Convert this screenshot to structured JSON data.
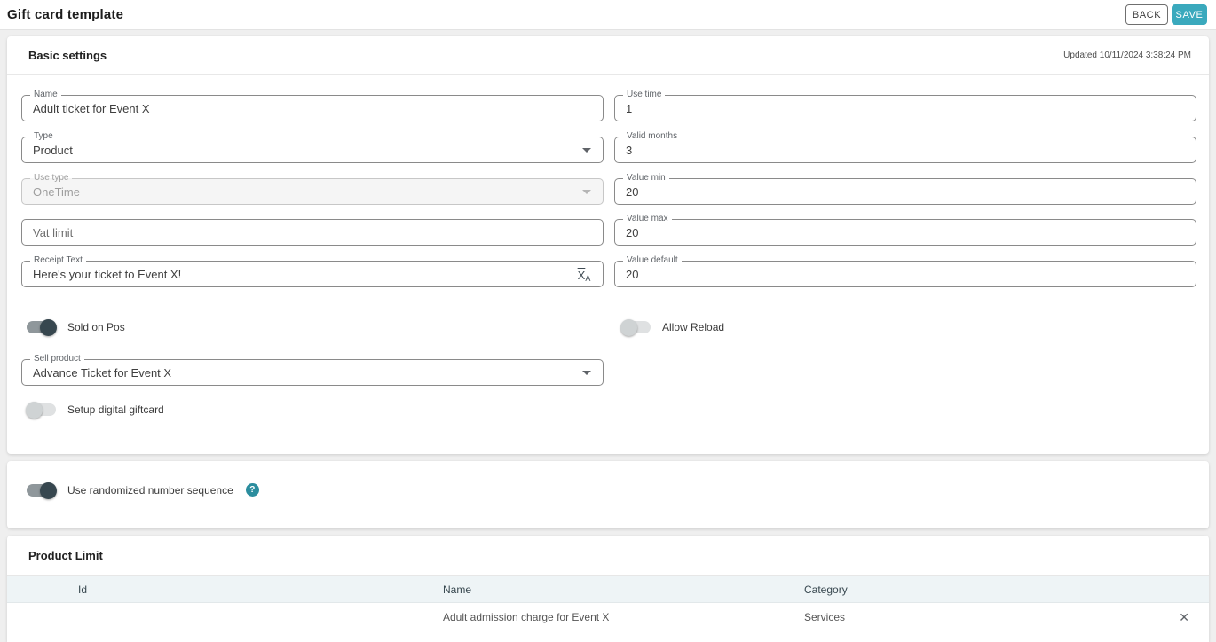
{
  "page": {
    "title": "Gift card template"
  },
  "actions": {
    "back_label": "BACK",
    "save_label": "SAVE"
  },
  "icons": {
    "help": "?",
    "remove": "✕",
    "translate_main": "X",
    "translate_sub": "A"
  },
  "colors": {
    "accent_teal": "#3aa9bd",
    "help_icon_teal": "#2b8d9e",
    "toggle_on_thumb": "#37474f",
    "table_header_bg": "#eef4f6"
  },
  "basic_settings": {
    "section_title": "Basic settings",
    "updated_text": "Updated 10/11/2024 3:38:24 PM",
    "name": {
      "label": "Name",
      "value": "Adult ticket for Event X"
    },
    "use_time": {
      "label": "Use time",
      "value": "1"
    },
    "type": {
      "label": "Type",
      "value": "Product"
    },
    "valid_months": {
      "label": "Valid months",
      "value": "3"
    },
    "use_type": {
      "label": "Use type",
      "value": "OneTime"
    },
    "value_min": {
      "label": "Value min",
      "value": "20"
    },
    "vat_limit": {
      "placeholder": "Vat limit"
    },
    "value_max": {
      "label": "Value max",
      "value": "20"
    },
    "receipt_text": {
      "label": "Receipt Text",
      "value": "Here's your ticket to Event X!"
    },
    "value_default": {
      "label": "Value default",
      "value": "20"
    },
    "sold_on_pos": {
      "label": "Sold on Pos",
      "on": true
    },
    "allow_reload": {
      "label": "Allow Reload",
      "on": false
    },
    "sell_product": {
      "label": "Sell product",
      "value": "Advance Ticket for Event X"
    },
    "setup_digital_giftcard": {
      "label": "Setup digital giftcard",
      "on": false
    }
  },
  "randomized_section": {
    "label": "Use randomized number sequence",
    "on": true
  },
  "product_limit": {
    "section_title": "Product Limit",
    "columns": [
      "Id",
      "Name",
      "Category"
    ],
    "rows": [
      {
        "id": "",
        "name": "Adult admission charge for Event X",
        "category": "Services"
      }
    ]
  }
}
